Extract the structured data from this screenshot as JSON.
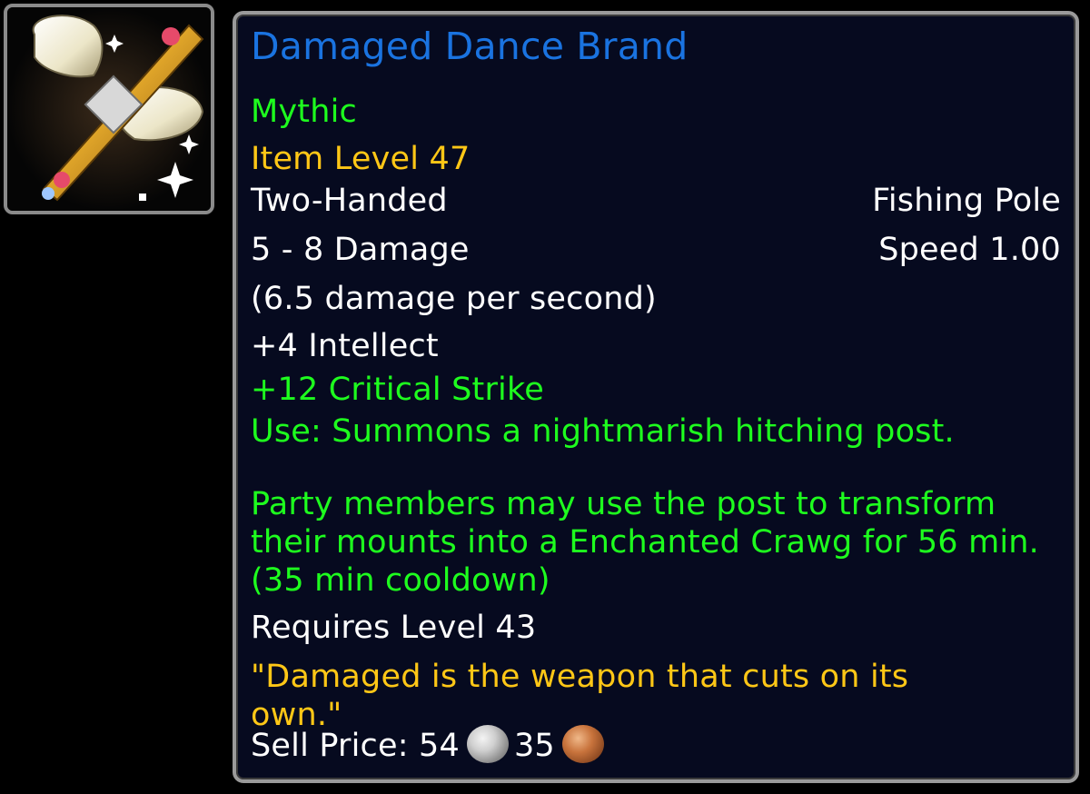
{
  "item": {
    "icon": "winged-golden-sword-icon",
    "name": "Damaged Dance Brand",
    "quality": "Mythic",
    "item_level": "Item Level 47",
    "slot": "Two-Handed",
    "type": "Fishing Pole",
    "damage": "5 - 8 Damage",
    "speed": "Speed 1.00",
    "dps": "(6.5 damage per second)",
    "stat_intellect": "+4 Intellect",
    "stat_crit": "+12 Critical Strike",
    "use_effect": "Use: Summons a nightmarish hitching post.",
    "use_effect_detail": "Party members may use the post to transform their mounts into a Enchanted Crawg for 56 min. (35 min cooldown)",
    "requirement": "Requires Level 43",
    "flavor": "\"Damaged is the weapon that cuts on its own.\"",
    "sell_label": "Sell Price:",
    "sell_silver": "54",
    "sell_copper": "35"
  },
  "colors": {
    "title": "#1a73e0",
    "quality": "#1eff1e",
    "item_level": "#ffc716",
    "flavor": "#ffc716",
    "effect": "#1eff1e",
    "background": "#060a1f"
  },
  "icons": {
    "silver_coin": "silver-coin-icon",
    "copper_coin": "copper-coin-icon"
  }
}
